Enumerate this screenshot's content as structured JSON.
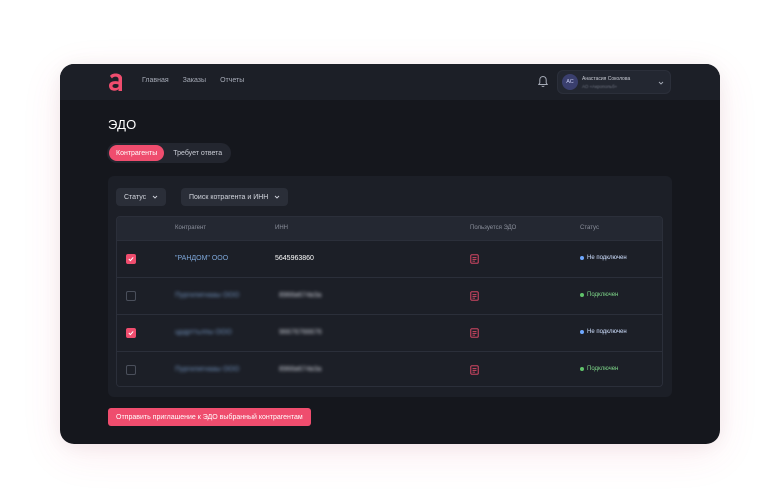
{
  "header": {
    "logo_letter": "a",
    "nav": [
      "Главная",
      "Заказы",
      "Отчеты"
    ],
    "user": {
      "initials": "АС",
      "name": "Анастасия Соколова",
      "org": "АО «Акропольб»"
    }
  },
  "page": {
    "title": "ЭДО",
    "tabs": [
      {
        "label": "Контрагенты",
        "active": true
      },
      {
        "label": "Требует ответа",
        "active": false
      }
    ]
  },
  "filters": {
    "status_label": "Статус",
    "search_label": "Поиск котрагента и ИНН"
  },
  "table": {
    "columns": [
      "Контрагент",
      "ИНН",
      "Пользуется ЭДО",
      "Статус"
    ],
    "rows": [
      {
        "checked": true,
        "name": "\"РАНДОМ\" ООО",
        "inn": "5645963860",
        "status": "Не подключен",
        "status_color": "#6fa8ff"
      },
      {
        "checked": false,
        "name": "Пургилигнааы ООО",
        "inn": "8966в674в3а",
        "status": "Подключен",
        "status_color": "#5fc26a"
      },
      {
        "checked": true,
        "name": "црдрттьлпы ООО",
        "inn": "96676766676",
        "status": "Не подключен",
        "status_color": "#6fa8ff"
      },
      {
        "checked": false,
        "name": "Пургилигнааы ООО",
        "inn": "8966в674в3а",
        "status": "Подключен",
        "status_color": "#5fc26a"
      }
    ]
  },
  "actions": {
    "send_invite": "Отправить приглашение к ЭДО выбранный контрагентам"
  },
  "colors": {
    "accent": "#ef4d6e",
    "background": "#15171d",
    "panel": "#1c1f27",
    "link": "#7da6d8"
  }
}
